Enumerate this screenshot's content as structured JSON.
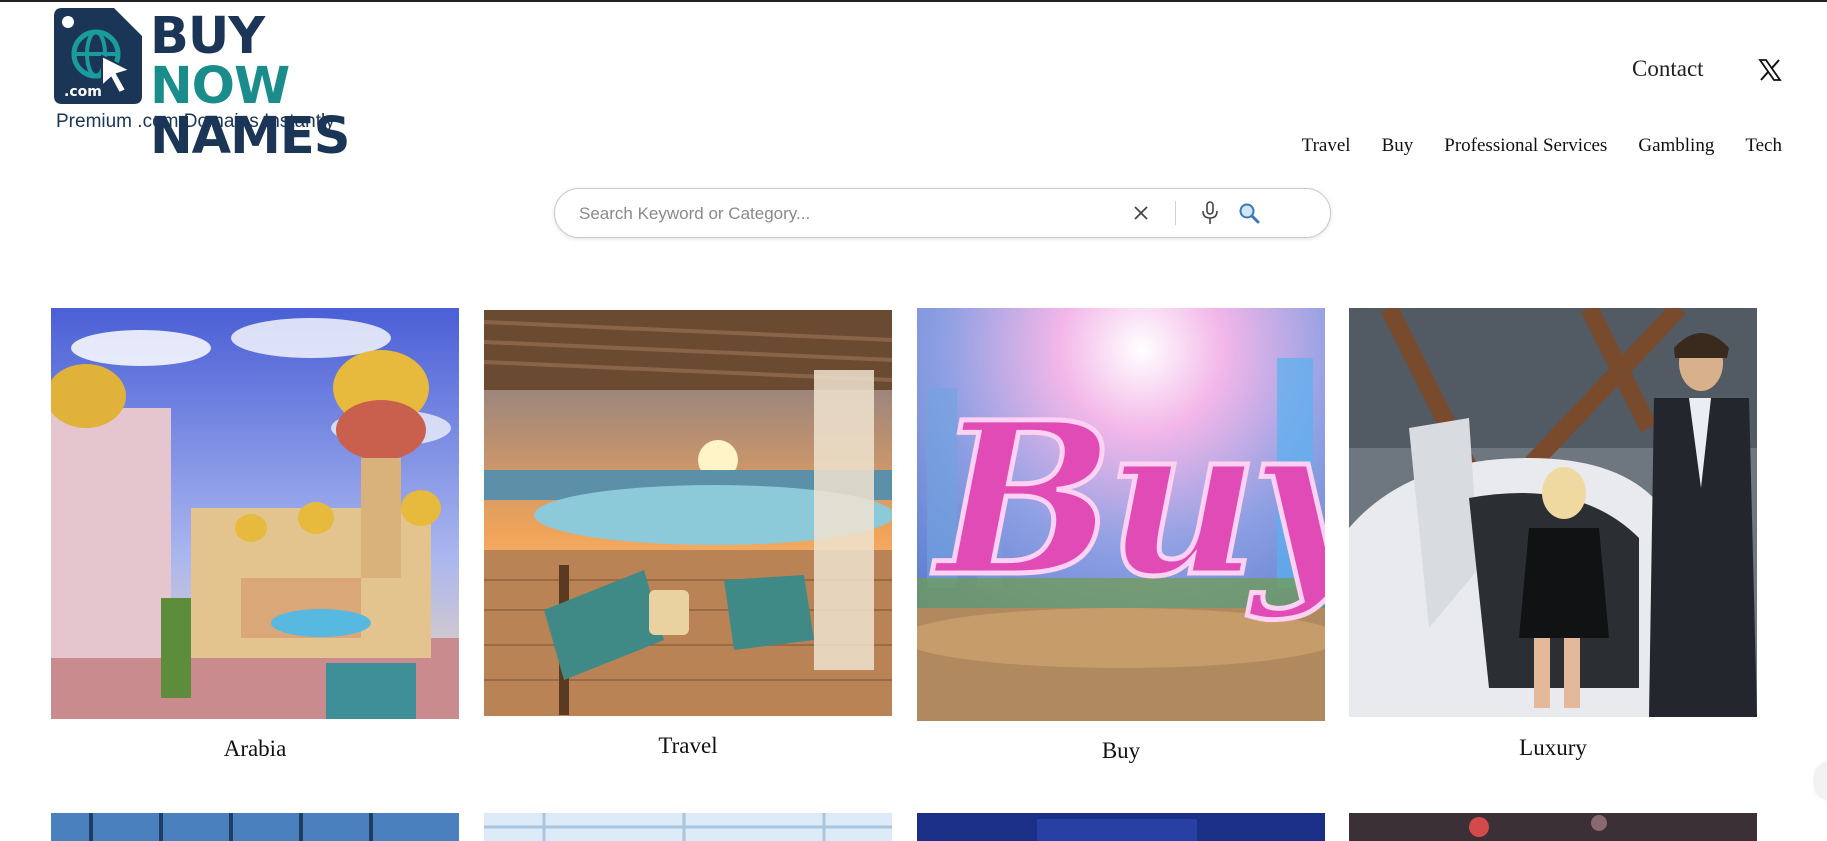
{
  "brand": {
    "word_buy": "BUY",
    "word_now": "NOW",
    "word_names": "NAMES",
    "tld": ".com",
    "tagline": "Premium .com Domains Instantly",
    "colors": {
      "navy": "#1b3557",
      "teal": "#1a8c8c"
    }
  },
  "header": {
    "contact_label": "Contact",
    "social_icon": "x-twitter-icon"
  },
  "category_nav": [
    "Travel",
    "Buy",
    "Professional Services",
    "Gambling",
    "Tech"
  ],
  "search": {
    "placeholder": "Search Keyword or Category...",
    "value": "",
    "icons": [
      "close-icon",
      "microphone-icon",
      "search-icon"
    ]
  },
  "cards": [
    {
      "label": "Arabia",
      "image": "palace-illustration"
    },
    {
      "label": "Travel",
      "image": "poolside-sunset"
    },
    {
      "label": "Buy",
      "image": "neon-buy-sign"
    },
    {
      "label": "Luxury",
      "image": "couple-sports-car"
    }
  ]
}
